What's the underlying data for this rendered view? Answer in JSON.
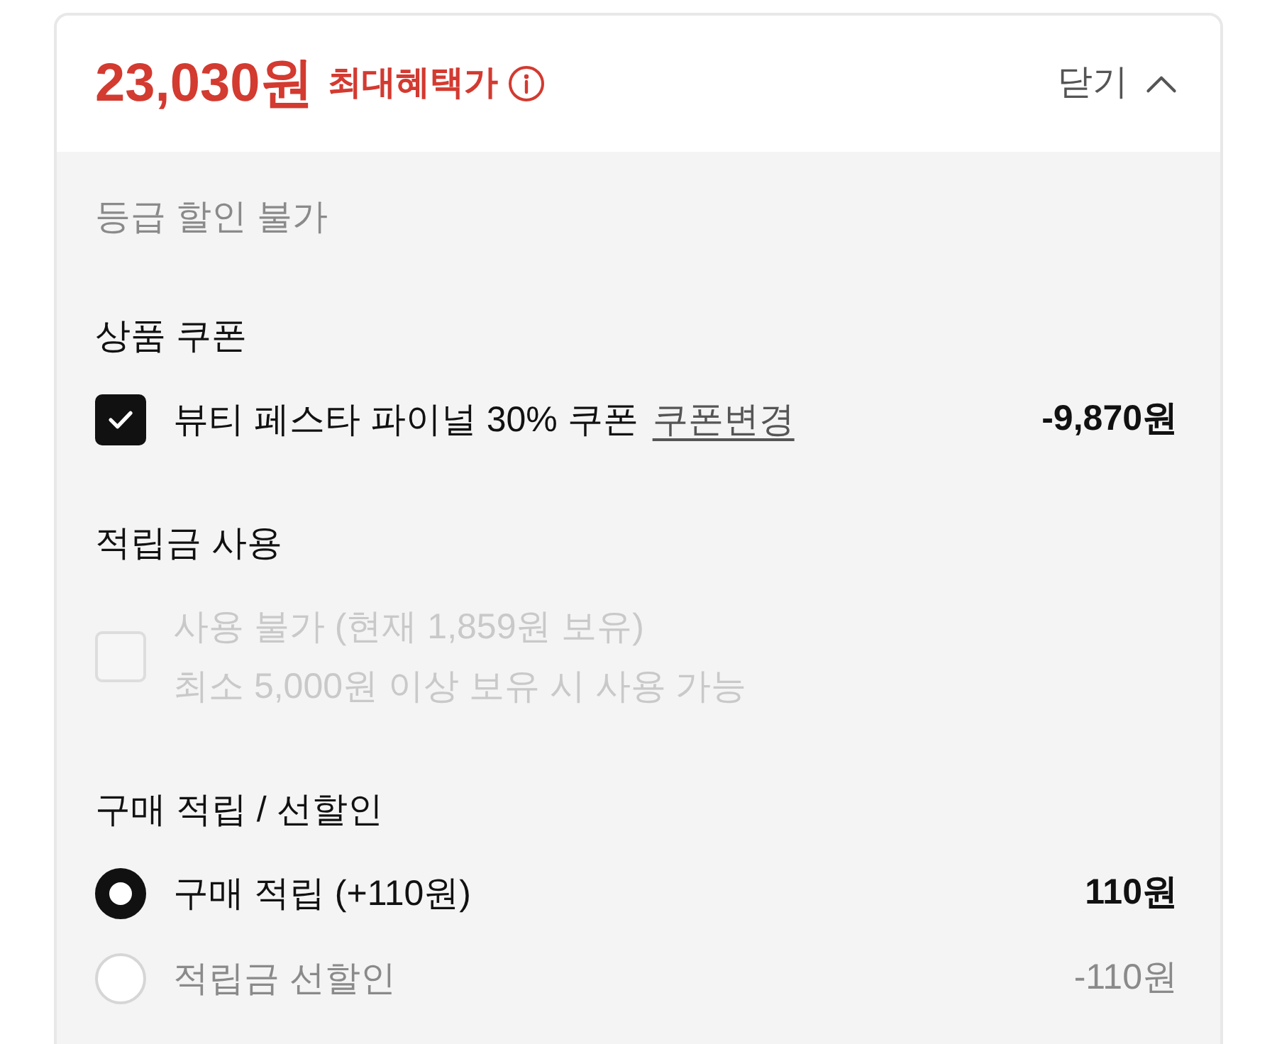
{
  "summary": {
    "price": "23,030원",
    "label": "최대혜택가",
    "toggle": "닫기",
    "expanded": true
  },
  "grade_discount": "등급 할인 불가",
  "sections": [
    {
      "title": "상품 쿠폰",
      "items": [
        {
          "kind": "checkbox",
          "checked": true,
          "disabled": false,
          "lines": [
            "뷰티 페스타 파이널 30% 쿠폰"
          ],
          "link": "쿠폰변경",
          "amount": "-9,870원"
        }
      ]
    },
    {
      "title": "적립금 사용",
      "items": [
        {
          "kind": "checkbox",
          "checked": false,
          "disabled": true,
          "lines": [
            "사용 불가 (현재 1,859원 보유)",
            "최소 5,000원 이상 보유 시 사용 가능"
          ]
        }
      ]
    },
    {
      "title": "구매 적립 / 선할인",
      "items": [
        {
          "kind": "radio",
          "selected": true,
          "lines": [
            "구매 적립 (+110원)"
          ],
          "amount": "110원"
        },
        {
          "kind": "radio",
          "selected": false,
          "lines": [
            "적립금 선할인"
          ],
          "amount": "-110원"
        }
      ]
    }
  ]
}
